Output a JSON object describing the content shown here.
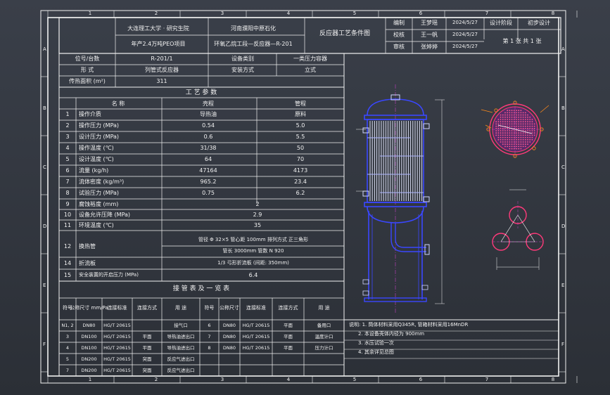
{
  "frame": {
    "top_ruler": [
      "1",
      "2",
      "3",
      "4",
      "5",
      "6",
      "7",
      "8"
    ],
    "side_ruler": [
      "A",
      "B",
      "C",
      "D",
      "E",
      "F"
    ]
  },
  "title_block": {
    "org": "大连理工大学 · 研究生院",
    "project_company": "河南濮阳中原石化",
    "drawing_title": "反应器工艺条件图",
    "sub_project": "年产2.4万吨PEO项目",
    "sub_unit": "环氧乙烷工段—反应器—R-201",
    "rows": [
      {
        "role": "编制",
        "name": "王梦瑶",
        "date": "2024/5/27"
      },
      {
        "role": "校核",
        "name": "王一帆",
        "date": "2024/5/27"
      },
      {
        "role": "审核",
        "name": "张婷婷",
        "date": "2024/5/27"
      }
    ],
    "stage_label": "设计阶段",
    "stage_value": "初步设计",
    "sheet": "第 1 张 共 1 张"
  },
  "basic_info": [
    {
      "k": "位号/台数",
      "v": "R-201/1",
      "k2": "设备类别",
      "v2": "一类压力容器"
    },
    {
      "k": "形 式",
      "v": "列管式反应器",
      "k2": "安装方式",
      "v2": "立式"
    },
    {
      "k": "传热面积 (m²)",
      "v": "311",
      "k2": "",
      "v2": ""
    }
  ],
  "process": {
    "title": "工 艺 参 数",
    "col_left": "名 称",
    "col_mid": "壳程",
    "col_right": "管程",
    "rows": [
      {
        "no": "1",
        "name": "操作介质",
        "shell": "导热油",
        "tube": "原料"
      },
      {
        "no": "2",
        "name": "操作压力 (MPa)",
        "shell": "0.54",
        "tube": "5.0"
      },
      {
        "no": "3",
        "name": "设计压力 (MPa)",
        "shell": "0.6",
        "tube": "5.5"
      },
      {
        "no": "4",
        "name": "操作温度 (℃)",
        "shell": "31/38",
        "tube": "50"
      },
      {
        "no": "5",
        "name": "设计温度 (℃)",
        "shell": "64",
        "tube": "70"
      },
      {
        "no": "6",
        "name": "流量 (kg/h)",
        "shell": "47164",
        "tube": "4173"
      },
      {
        "no": "7",
        "name": "流体密度 (kg/m³)",
        "shell": "965.2",
        "tube": "23.4"
      },
      {
        "no": "8",
        "name": "试验压力 (MPa)",
        "shell": "0.75",
        "tube": "6.2"
      }
    ],
    "merged_rows": [
      {
        "no": "9",
        "name": "腐蚀裕度 (mm)",
        "value": "2"
      },
      {
        "no": "10",
        "name": "设备允许压降 (MPa)",
        "value": "2.9"
      },
      {
        "no": "11",
        "name": "环境温度 (℃)",
        "value": "35"
      }
    ],
    "tube_row": {
      "no": "12",
      "name": "换热管",
      "line1": "管径 Φ 32×5  管心距 100mm  排列方式 正三角形",
      "line2": "管长 3000mm  管数 N 920"
    },
    "baffle_row": {
      "no": "14",
      "name": "折流板",
      "value": "1/3 弓形折流板  (间距: 350mm)"
    },
    "safety_row": {
      "no": "15",
      "name": "安全装置的开启压力 (MPa)",
      "value": "6.4"
    }
  },
  "nozzle_table": {
    "title": "接 管 表 及 一 览 表",
    "headers": [
      "符号",
      "公称尺寸 mm/Pa",
      "连接标准",
      "连接方式",
      "用 途",
      "符号",
      "公称尺寸",
      "连接标准",
      "连接方式",
      "用 途"
    ],
    "rows": [
      [
        "N1, 2",
        "DN80",
        "HG/T 20615",
        "",
        "接气口",
        "6",
        "DN80",
        "HG/T 20615",
        "平面",
        "备用口"
      ],
      [
        "3",
        "DN100",
        "HG/T 20615",
        "平面",
        "导热油进出口",
        "7",
        "DN80",
        "HG/T 20615",
        "平面",
        "温度计口"
      ],
      [
        "4",
        "DN100",
        "HG/T 20615",
        "平面",
        "导热油进出口",
        "8",
        "DN80",
        "HG/T 20615",
        "平面",
        "压力计口"
      ],
      [
        "5",
        "DN200",
        "HG/T 20615",
        "突面",
        "反应气进出口",
        "",
        "",
        "",
        "",
        ""
      ],
      [
        "7",
        "DN200",
        "HG/T 20615",
        "突面",
        "反应气进出口",
        "",
        "",
        "",
        "",
        ""
      ]
    ]
  },
  "notes": [
    "说明: 1. 筒体材料采用Q345R, 管箱材料采用16MnDR",
    "2. 本设备壳体内径为 900mm",
    "3. 水压试验一次",
    "4. 其余详见总图"
  ],
  "colors": {
    "background": "#2f343c",
    "frame": "#f2f2f2",
    "vessel": "#3a47ff",
    "detail": "#ff3a7a",
    "centerline": "#c040c0",
    "hatch": "#c060c0",
    "nozzle": "#d0d4ff",
    "leader": "#ff8a1a"
  }
}
